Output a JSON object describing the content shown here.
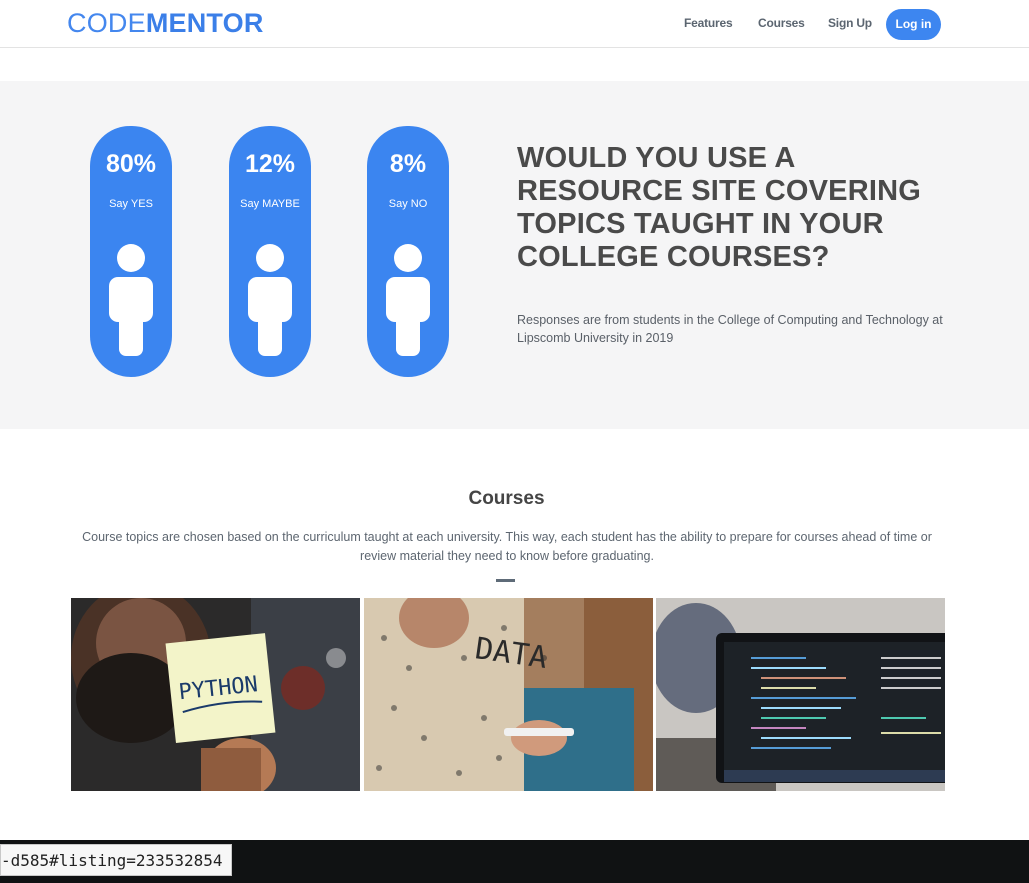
{
  "header": {
    "logo_part1": "CODE",
    "logo_part2": "MENTOR",
    "nav": [
      "Features",
      "Courses",
      "Sign Up"
    ],
    "login_label": "Log in"
  },
  "survey": {
    "stats": [
      {
        "percent": "80%",
        "label": "Say YES"
      },
      {
        "percent": "12%",
        "label": "Say MAYBE"
      },
      {
        "percent": "8%",
        "label": "Say NO"
      }
    ],
    "question": "WOULD YOU USE A RESOURCE SITE COVERING TOPICS TAUGHT IN YOUR COLLEGE COURSES?",
    "note": "Responses are from students in the College of Computing and Technology at Lipscomb University in 2019"
  },
  "courses": {
    "title": "Courses",
    "description": "Course topics are chosen based on the curriculum taught at each university. This way, each student has the ability to prepare for courses ahead of time or review material they need to know before graduating.",
    "photo1_note_text": "PYTHON",
    "photo2_glass_text": "DATA"
  },
  "status_bar": {
    "url": "-d585#listing=233532854"
  },
  "colors": {
    "brand_blue": "#3b85f0",
    "survey_bg": "#f5f5f6",
    "text_dark": "#4a4a4a"
  }
}
